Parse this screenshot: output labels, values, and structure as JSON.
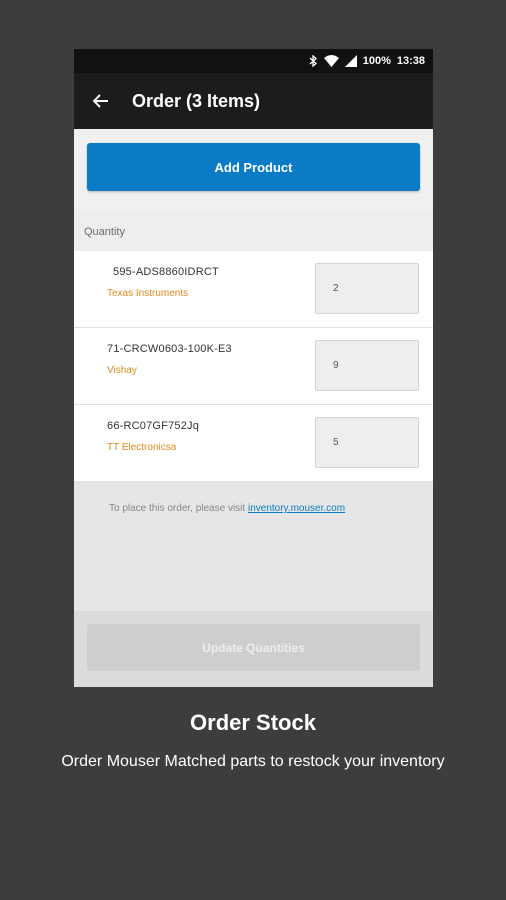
{
  "status_bar": {
    "battery": "100%",
    "time": "13:38"
  },
  "app_bar": {
    "title": "Order (3 Items)"
  },
  "add_product_label": "Add Product",
  "quantity_header": "Quantity",
  "items": [
    {
      "part_number": "595-ADS8860IDRCT",
      "manufacturer": "Texas Instruments",
      "quantity": "2"
    },
    {
      "part_number": "71-CRCW0603-100K-E3",
      "manufacturer": "Vishay",
      "quantity": "9"
    },
    {
      "part_number": "66-RC07GF752Jq",
      "manufacturer": "TT Electronicsa",
      "quantity": "5"
    }
  ],
  "note": {
    "text": "To place this order, please visit ",
    "link": "inventory.mouser.com"
  },
  "update_label": "Update Quantities",
  "caption": {
    "title": "Order Stock",
    "subtitle": "Order Mouser Matched parts to restock your inventory"
  },
  "colors": {
    "accent": "#0a7bc4",
    "manufacturer": "#e08a1e",
    "background": "#3d3d3d"
  }
}
